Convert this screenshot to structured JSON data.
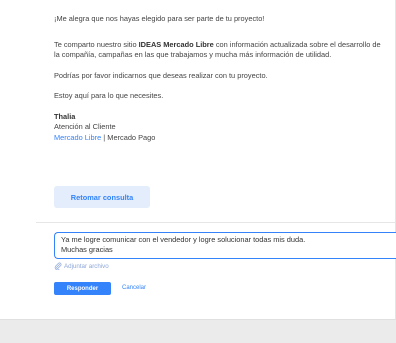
{
  "message": {
    "greeting": "¡Me alegra que nos hayas elegido para ser parte de tu proyecto!",
    "p2_before": "Te comparto nuestro sitio ",
    "p2_bold": "IDEAS Mercado Libre",
    "p2_after": " con información actualizada sobre el desarrollo de la compañía, campañas en las que trabajamos y mucha más información de utilidad.",
    "p3": "Podrías por favor indicarnos que deseas realizar con tu proyecto.",
    "p4": "Estoy aquí para lo que necesites.",
    "signature": {
      "name": "Thalia",
      "role": "Atención al Cliente",
      "link1": "Mercado Libre",
      "separator": " | ",
      "link2": "Mercado Pago"
    }
  },
  "retomar_label": "Retomar consulta",
  "reply": {
    "value": "Ya me logre comunicar con el vendedor y logre solucionar todas mis duda.\nMuchas gracias"
  },
  "attach_label": "Adjuntar archivo",
  "actions": {
    "send_label": "Responder",
    "cancel_label": "Cancelar"
  },
  "colors": {
    "accent": "#3483fa",
    "page_bg": "#ebebeb",
    "card_bg": "#ffffff"
  }
}
